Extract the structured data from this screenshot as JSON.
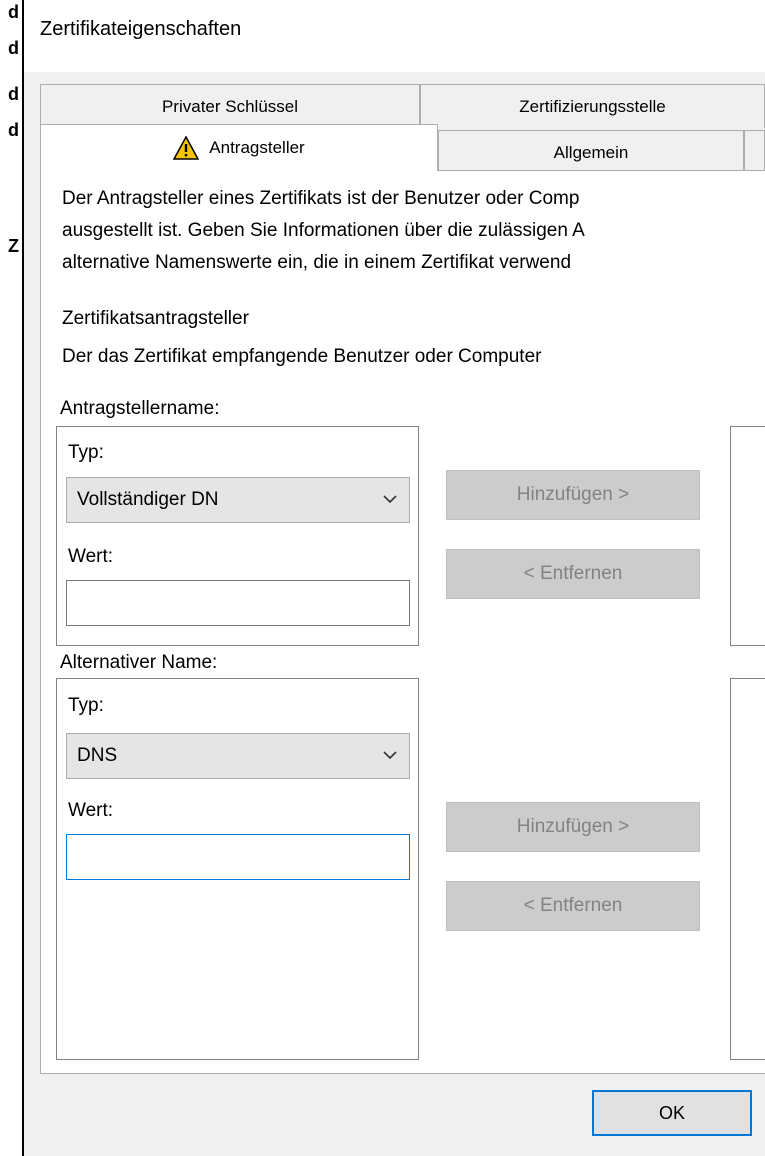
{
  "background_window": {
    "fragments": [
      "d",
      "d",
      "d",
      "Z"
    ]
  },
  "dialog": {
    "title": "Zertifikateigenschaften",
    "tabs_row1": [
      "Privater Schlüssel",
      "Zertifizierungsstelle"
    ],
    "tabs_row2": [
      "Antragsteller",
      "Allgemein"
    ],
    "active_tab": "Antragsteller"
  },
  "content": {
    "description_lines": [
      "Der Antragsteller eines Zertifikats ist der Benutzer oder Comp",
      "ausgestellt ist. Geben Sie Informationen über die zulässigen A",
      "alternative Namenswerte ein, die in einem Zertifikat verwend"
    ],
    "section_title": "Zertifikatsantragsteller",
    "section_subtitle": "Der das Zertifikat empfangende Benutzer oder Computer"
  },
  "subject_name": {
    "label": "Antragstellername:",
    "type_label": "Typ:",
    "type_value": "Vollständiger DN",
    "value_label": "Wert:",
    "value": "",
    "add_label": "Hinzufügen >",
    "remove_label": "< Entfernen"
  },
  "alt_name": {
    "label": "Alternativer Name:",
    "type_label": "Typ:",
    "type_value": "DNS",
    "value_label": "Wert:",
    "value": "",
    "add_label": "Hinzufügen >",
    "remove_label": "< Entfernen"
  },
  "footer": {
    "ok_label": "OK"
  },
  "colors": {
    "focus": "#0078d7",
    "disabled_text": "#838383",
    "warning": "#f5c400"
  }
}
